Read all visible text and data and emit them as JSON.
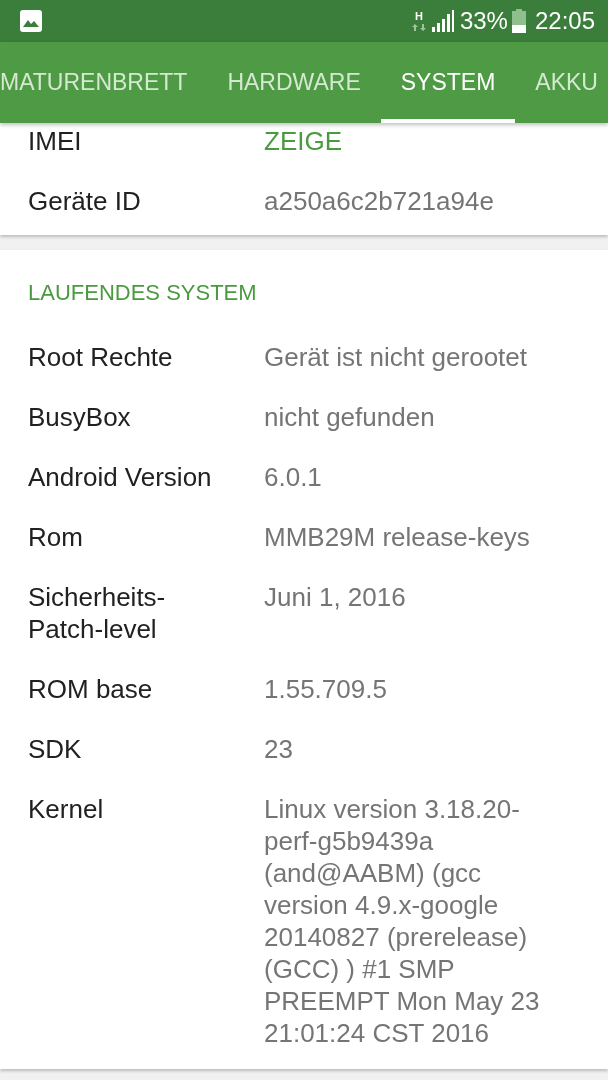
{
  "status_bar": {
    "network": "H",
    "battery": "33%",
    "time": "22:05"
  },
  "tabs": [
    {
      "label": "MATURENBRETT",
      "selected": false
    },
    {
      "label": "HARDWARE",
      "selected": false
    },
    {
      "label": "SYSTEM",
      "selected": true
    },
    {
      "label": "AKKU",
      "selected": false
    }
  ],
  "sections": [
    {
      "rows": [
        {
          "label": "IMEI",
          "value": "ZEIGE",
          "kind": "link"
        },
        {
          "label": "Geräte ID",
          "value": "a250a6c2b721a94e",
          "kind": "text"
        }
      ]
    },
    {
      "title": "LAUFENDES SYSTEM",
      "rows": [
        {
          "label": "Root Rechte",
          "value": "Gerät ist nicht gerootet",
          "kind": "text"
        },
        {
          "label": "BusyBox",
          "value": "nicht gefunden",
          "kind": "text"
        },
        {
          "label": "Android Version",
          "value": "6.0.1",
          "kind": "text"
        },
        {
          "label": "Rom",
          "value": "MMB29M release-keys",
          "kind": "text"
        },
        {
          "label": "Sicherheits-Patch-level",
          "value": "Juni 1, 2016",
          "kind": "text"
        },
        {
          "label": "ROM base",
          "value": "1.55.709.5",
          "kind": "text"
        },
        {
          "label": "SDK",
          "value": "23",
          "kind": "text"
        },
        {
          "label": "Kernel",
          "value": "Linux version 3.18.20-perf-g5b9439a (and@AABM) (gcc version 4.9.x-google 20140827 (prerelease) (GCC) ) #1 SMP PREEMPT Mon May 23 21:01:24 CST 2016",
          "kind": "text"
        }
      ]
    }
  ]
}
